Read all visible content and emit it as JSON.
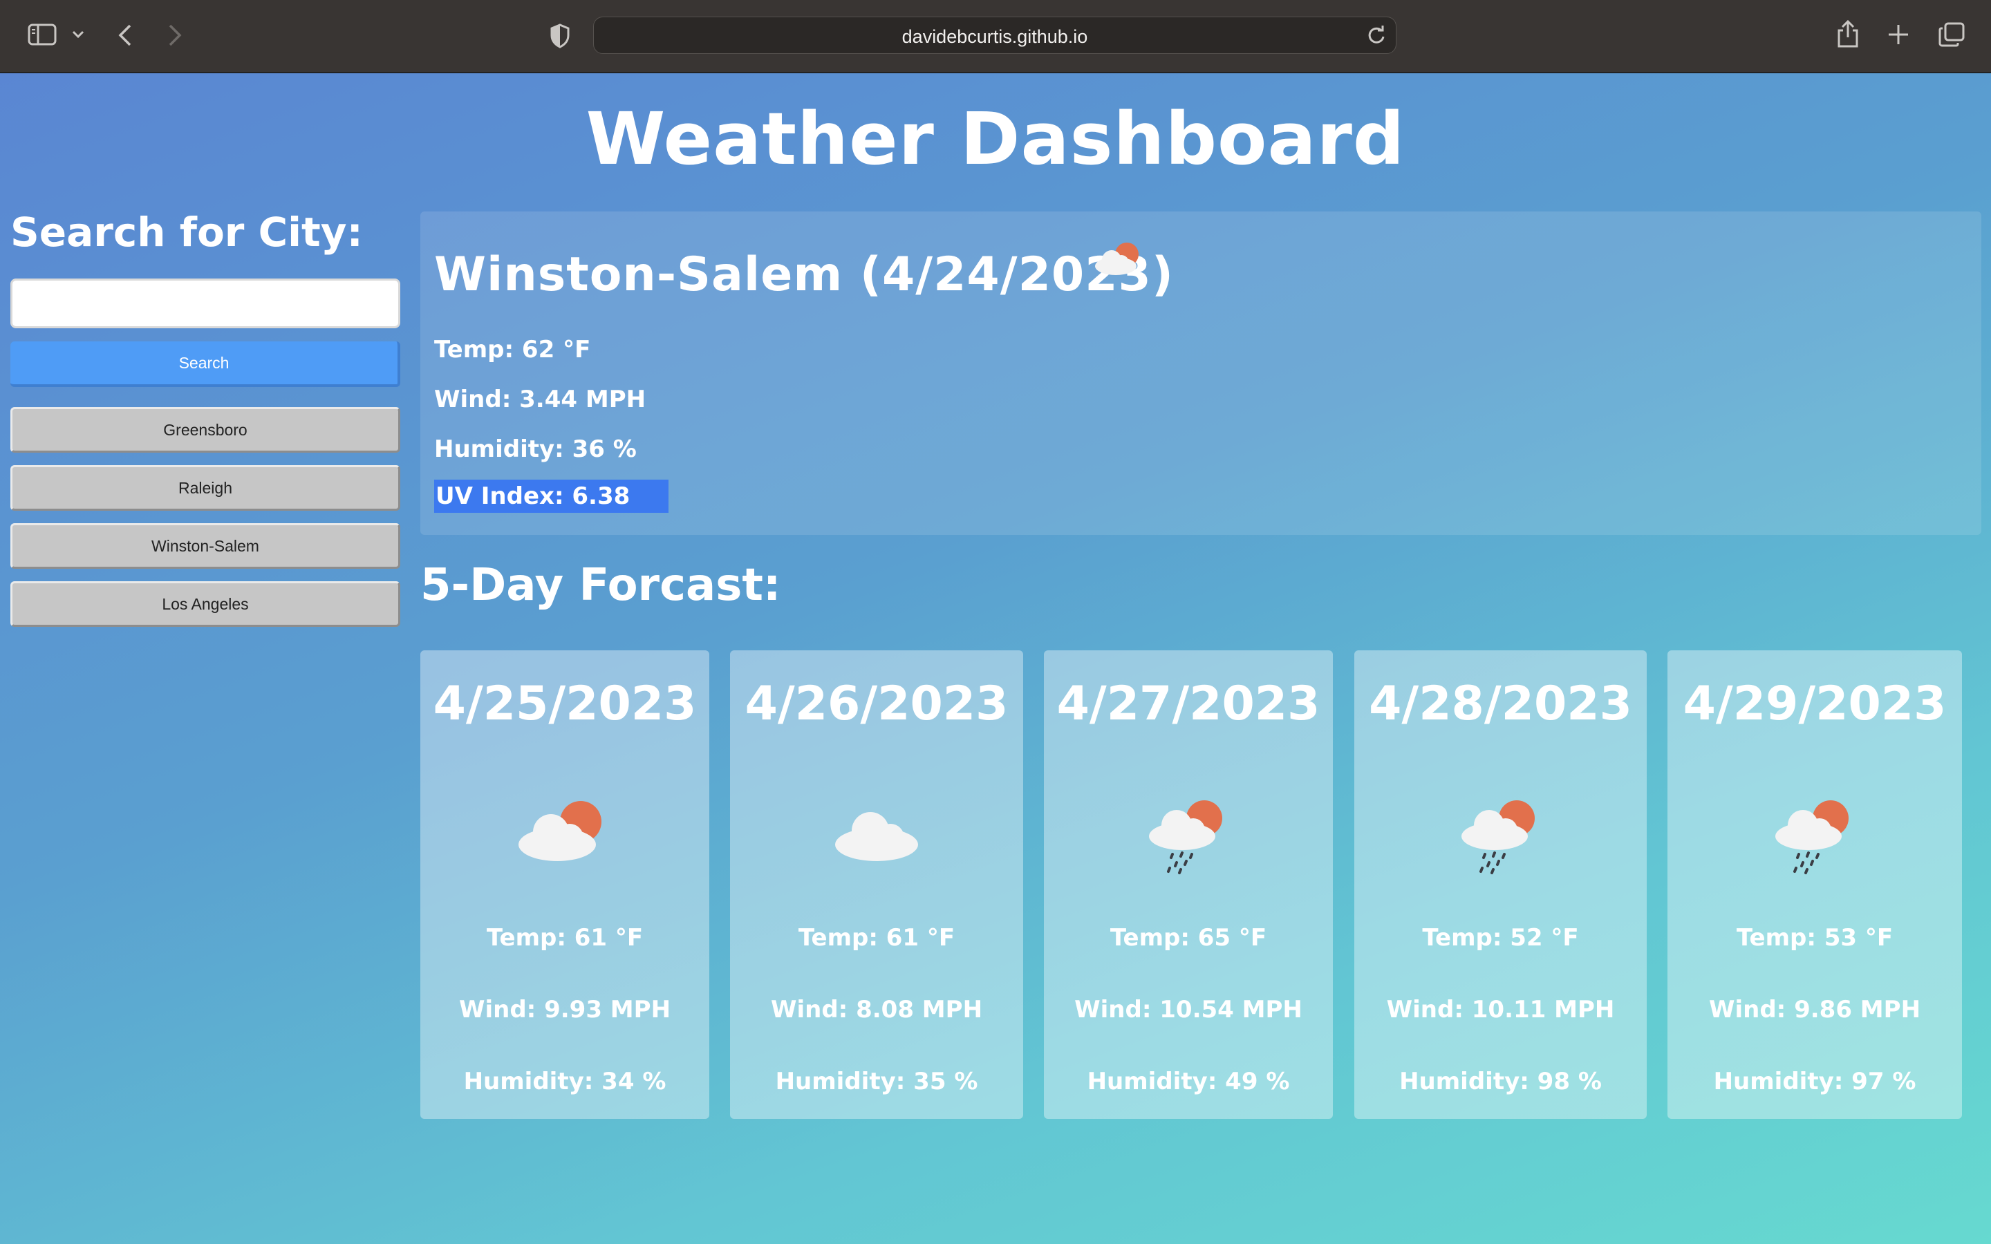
{
  "browser": {
    "url": "davidebcurtis.github.io"
  },
  "page": {
    "title": "Weather Dashboard"
  },
  "search": {
    "heading": "Search for City:",
    "input_value": "",
    "button_label": "Search"
  },
  "history": [
    "Greensboro",
    "Raleigh",
    "Winston-Salem",
    "Los Angeles"
  ],
  "current": {
    "city_date": "Winston-Salem (4/24/2023)",
    "icon": "partly-cloudy-icon",
    "temp": "Temp: 62 °F",
    "wind": "Wind: 3.44 MPH",
    "humidity": "Humidity: 36 %",
    "uv": "UV Index: 6.38",
    "uv_color": "#3c79ef"
  },
  "forecast": {
    "heading": "5-Day Forcast:",
    "days": [
      {
        "date": "4/25/2023",
        "icon": "partly-cloudy-icon",
        "temp": "Temp: 61 °F",
        "wind": "Wind: 9.93 MPH",
        "humidity": "Humidity: 34 %"
      },
      {
        "date": "4/26/2023",
        "icon": "cloud-icon",
        "temp": "Temp: 61 °F",
        "wind": "Wind: 8.08 MPH",
        "humidity": "Humidity: 35 %"
      },
      {
        "date": "4/27/2023",
        "icon": "rain-sun-icon",
        "temp": "Temp: 65 °F",
        "wind": "Wind: 10.54 MPH",
        "humidity": "Humidity: 49 %"
      },
      {
        "date": "4/28/2023",
        "icon": "rain-sun-icon",
        "temp": "Temp: 52 °F",
        "wind": "Wind: 10.11 MPH",
        "humidity": "Humidity: 98 %"
      },
      {
        "date": "4/29/2023",
        "icon": "rain-sun-icon",
        "temp": "Temp: 53 °F",
        "wind": "Wind: 9.86 MPH",
        "humidity": "Humidity: 97 %"
      }
    ]
  }
}
